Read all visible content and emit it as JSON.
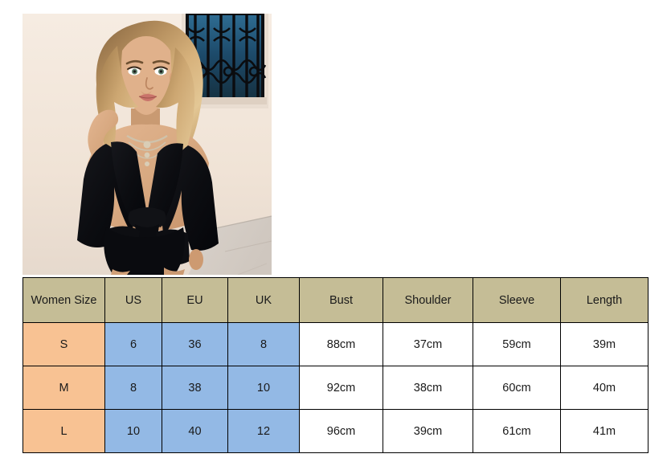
{
  "photo": {
    "alt": "Fashion model wearing black tie-front long sleeve top and bodysuit in front of a stucco wall with wrought iron window grille",
    "subject": "female-model",
    "garment": "black tie-front long sleeve top",
    "background": "beige stucco wall with black wrought iron window grille"
  },
  "size_chart": {
    "headers": [
      "Women Size",
      "US",
      "EU",
      "UK",
      "Bust",
      "Shoulder",
      "Sleeve",
      "Length"
    ],
    "rows": [
      {
        "size": "S",
        "us": "6",
        "eu": "36",
        "uk": "8",
        "bust": "88cm",
        "shoulder": "37cm",
        "sleeve": "59cm",
        "length": "39m"
      },
      {
        "size": "M",
        "us": "8",
        "eu": "38",
        "uk": "10",
        "bust": "92cm",
        "shoulder": "38cm",
        "sleeve": "60cm",
        "length": "40m"
      },
      {
        "size": "L",
        "us": "10",
        "eu": "40",
        "uk": "12",
        "bust": "96cm",
        "shoulder": "39cm",
        "sleeve": "61cm",
        "length": "41m"
      }
    ],
    "colors": {
      "header_bg": "#c5bd96",
      "size_cell_bg": "#f8c293",
      "numeric_cell_bg": "#93b9e5",
      "measure_cell_bg": "#ffffff",
      "border": "#000000",
      "text": "#1a1a1a"
    }
  }
}
